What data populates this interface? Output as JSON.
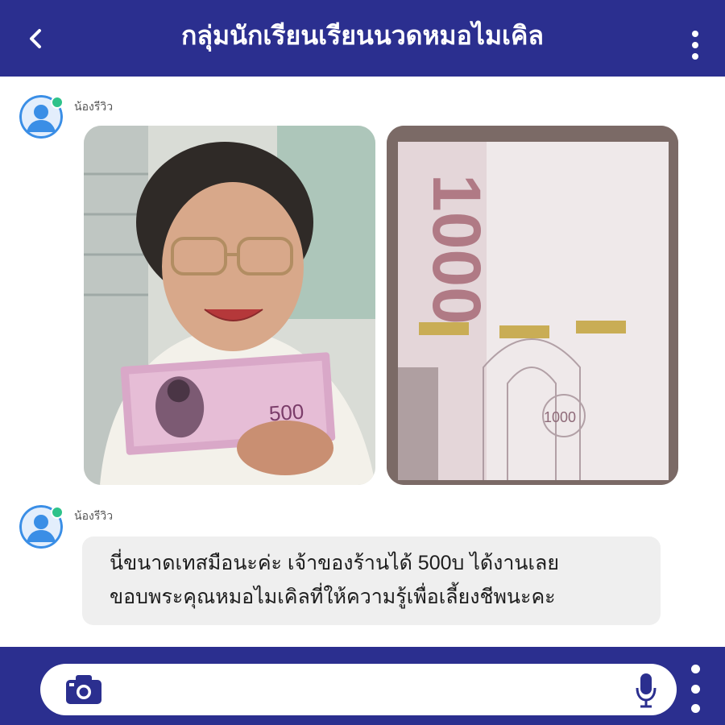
{
  "header": {
    "title": "กลุ่มนักเรียนเรียนนวดหมอไมเคิล",
    "back_icon": "chevron-left-icon",
    "menu_icon": "kebab-menu-icon"
  },
  "messages": [
    {
      "sender": "น้องรีวิว",
      "type": "photos",
      "photos": [
        {
          "subject": "woman holding a 500 baht banknote",
          "banknote_value": "500"
        },
        {
          "subject": "close-up of 1000 baht banknote",
          "banknote_value": "1000"
        }
      ]
    },
    {
      "sender": "น้องรีวิว",
      "type": "text",
      "lines": [
        "นี่ขนาดเทสมือนะค่ะ เจ้าของร้านได้ 500บ ได้งานเลย",
        "ขอบพระคุณหมอไมเคิลที่ให้ความรู้เพื่อเลี้ยงชีพนะคะ"
      ]
    }
  ],
  "composer": {
    "camera_icon": "camera-icon",
    "mic_icon": "microphone-icon",
    "more_icon": "kebab-menu-icon"
  },
  "colors": {
    "brand": "#2b2f8f",
    "avatar_ring": "#3a8ee6",
    "online": "#2ec28a",
    "bubble": "#efefef"
  }
}
